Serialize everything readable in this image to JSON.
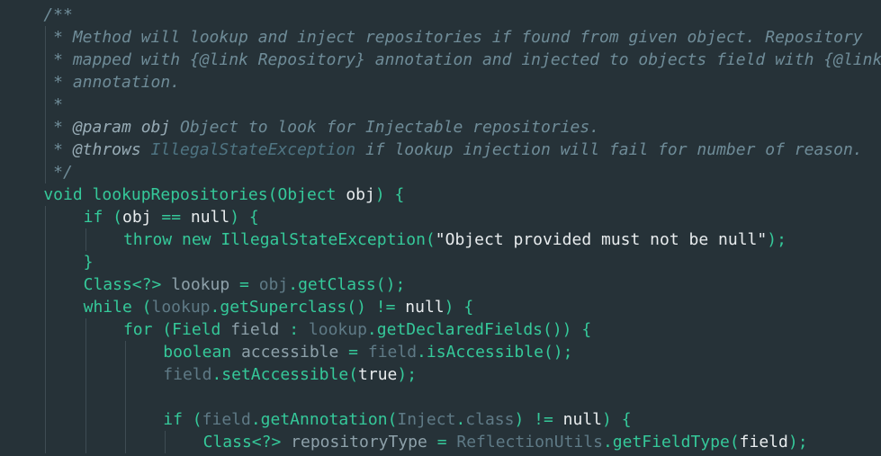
{
  "editor": {
    "colors": {
      "background": "#263238",
      "comment": "#6f8c98",
      "keyword": "#35c99a",
      "text": "#e8ecee",
      "dim": "#5f7a86"
    },
    "lines": [
      {
        "indent": 1,
        "tokens": [
          {
            "t": "/**",
            "c": "comment"
          }
        ]
      },
      {
        "indent": 1,
        "tokens": [
          {
            "t": " * Method will lookup and inject repositories if found from given object. Repository",
            "c": "comment"
          }
        ]
      },
      {
        "indent": 1,
        "tokens": [
          {
            "t": " * mapped with {@link Repository} annotation and injected to objects field with {@link",
            "c": "comment"
          }
        ]
      },
      {
        "indent": 1,
        "tokens": [
          {
            "t": " * annotation.",
            "c": "comment"
          }
        ]
      },
      {
        "indent": 1,
        "tokens": [
          {
            "t": " *",
            "c": "comment"
          }
        ]
      },
      {
        "indent": 1,
        "tokens": [
          {
            "t": " * ",
            "c": "comment"
          },
          {
            "t": "@param",
            "c": "doctag"
          },
          {
            "t": " ",
            "c": "comment"
          },
          {
            "t": "obj",
            "c": "docparam"
          },
          {
            "t": " Object to look for Injectable repositories.",
            "c": "comment"
          }
        ]
      },
      {
        "indent": 1,
        "tokens": [
          {
            "t": " * ",
            "c": "comment"
          },
          {
            "t": "@throws",
            "c": "doctag"
          },
          {
            "t": " ",
            "c": "comment"
          },
          {
            "t": "IllegalStateException",
            "c": "docref"
          },
          {
            "t": " if lookup injection will fail for number of reason.",
            "c": "comment"
          }
        ]
      },
      {
        "indent": 1,
        "tokens": [
          {
            "t": " */",
            "c": "comment"
          }
        ]
      },
      {
        "indent": 1,
        "tokens": [
          {
            "t": "void",
            "c": "keyword"
          },
          {
            "t": " ",
            "c": "plain"
          },
          {
            "t": "lookupRepositories",
            "c": "method"
          },
          {
            "t": "(",
            "c": "punct"
          },
          {
            "t": "Object",
            "c": "type"
          },
          {
            "t": " ",
            "c": "plain"
          },
          {
            "t": "obj",
            "c": "param"
          },
          {
            "t": ") {",
            "c": "punct"
          }
        ]
      },
      {
        "indent": 2,
        "tokens": [
          {
            "t": "if",
            "c": "keyword"
          },
          {
            "t": " (",
            "c": "punct"
          },
          {
            "t": "obj",
            "c": "param"
          },
          {
            "t": " == ",
            "c": "operator"
          },
          {
            "t": "null",
            "c": "literal"
          },
          {
            "t": ") {",
            "c": "punct"
          }
        ]
      },
      {
        "indent": 3,
        "tokens": [
          {
            "t": "throw",
            "c": "keyword"
          },
          {
            "t": " ",
            "c": "plain"
          },
          {
            "t": "new",
            "c": "keyword"
          },
          {
            "t": " ",
            "c": "plain"
          },
          {
            "t": "IllegalStateException",
            "c": "type"
          },
          {
            "t": "(",
            "c": "punct"
          },
          {
            "t": "\"Object provided must not be null\"",
            "c": "string"
          },
          {
            "t": ");",
            "c": "punct"
          }
        ]
      },
      {
        "indent": 2,
        "tokens": [
          {
            "t": "}",
            "c": "punct"
          }
        ]
      },
      {
        "indent": 2,
        "tokens": [
          {
            "t": "Class<?>",
            "c": "type"
          },
          {
            "t": " ",
            "c": "plain"
          },
          {
            "t": "lookup",
            "c": "local"
          },
          {
            "t": " = ",
            "c": "operator"
          },
          {
            "t": "obj",
            "c": "localuse"
          },
          {
            "t": ".",
            "c": "punct"
          },
          {
            "t": "getClass",
            "c": "method"
          },
          {
            "t": "();",
            "c": "punct"
          }
        ]
      },
      {
        "indent": 2,
        "tokens": [
          {
            "t": "while",
            "c": "keyword"
          },
          {
            "t": " (",
            "c": "punct"
          },
          {
            "t": "lookup",
            "c": "localuse"
          },
          {
            "t": ".",
            "c": "punct"
          },
          {
            "t": "getSuperclass",
            "c": "method"
          },
          {
            "t": "() != ",
            "c": "punct"
          },
          {
            "t": "null",
            "c": "literal"
          },
          {
            "t": ") {",
            "c": "punct"
          }
        ]
      },
      {
        "indent": 3,
        "tokens": [
          {
            "t": "for",
            "c": "keyword"
          },
          {
            "t": " (",
            "c": "punct"
          },
          {
            "t": "Field",
            "c": "type"
          },
          {
            "t": " ",
            "c": "plain"
          },
          {
            "t": "field",
            "c": "local"
          },
          {
            "t": " : ",
            "c": "operator"
          },
          {
            "t": "lookup",
            "c": "localuse"
          },
          {
            "t": ".",
            "c": "punct"
          },
          {
            "t": "getDeclaredFields",
            "c": "method"
          },
          {
            "t": "()) {",
            "c": "punct"
          }
        ]
      },
      {
        "indent": 4,
        "tokens": [
          {
            "t": "boolean",
            "c": "keyword"
          },
          {
            "t": " ",
            "c": "plain"
          },
          {
            "t": "accessible",
            "c": "local"
          },
          {
            "t": " = ",
            "c": "operator"
          },
          {
            "t": "field",
            "c": "localuse"
          },
          {
            "t": ".",
            "c": "punct"
          },
          {
            "t": "isAccessible",
            "c": "method"
          },
          {
            "t": "();",
            "c": "punct"
          }
        ]
      },
      {
        "indent": 4,
        "tokens": [
          {
            "t": "field",
            "c": "localuse"
          },
          {
            "t": ".",
            "c": "punct"
          },
          {
            "t": "setAccessible",
            "c": "method"
          },
          {
            "t": "(",
            "c": "punct"
          },
          {
            "t": "true",
            "c": "literal"
          },
          {
            "t": ");",
            "c": "punct"
          }
        ]
      },
      {
        "indent": 0,
        "tokens": []
      },
      {
        "indent": 4,
        "tokens": [
          {
            "t": "if",
            "c": "keyword"
          },
          {
            "t": " (",
            "c": "punct"
          },
          {
            "t": "field",
            "c": "localuse"
          },
          {
            "t": ".",
            "c": "punct"
          },
          {
            "t": "getAnnotation",
            "c": "method"
          },
          {
            "t": "(",
            "c": "punct"
          },
          {
            "t": "Inject",
            "c": "classref"
          },
          {
            "t": ".",
            "c": "punct"
          },
          {
            "t": "class",
            "c": "classref"
          },
          {
            "t": ") != ",
            "c": "punct"
          },
          {
            "t": "null",
            "c": "literal"
          },
          {
            "t": ") {",
            "c": "punct"
          }
        ]
      },
      {
        "indent": 5,
        "tokens": [
          {
            "t": "Class<?>",
            "c": "type"
          },
          {
            "t": " ",
            "c": "plain"
          },
          {
            "t": "repositoryType",
            "c": "local"
          },
          {
            "t": " = ",
            "c": "operator"
          },
          {
            "t": "ReflectionUtils",
            "c": "classref"
          },
          {
            "t": ".",
            "c": "punct"
          },
          {
            "t": "getFieldType",
            "c": "method"
          },
          {
            "t": "(",
            "c": "punct"
          },
          {
            "t": "field",
            "c": "param"
          },
          {
            "t": ");",
            "c": "punct"
          }
        ]
      }
    ]
  }
}
